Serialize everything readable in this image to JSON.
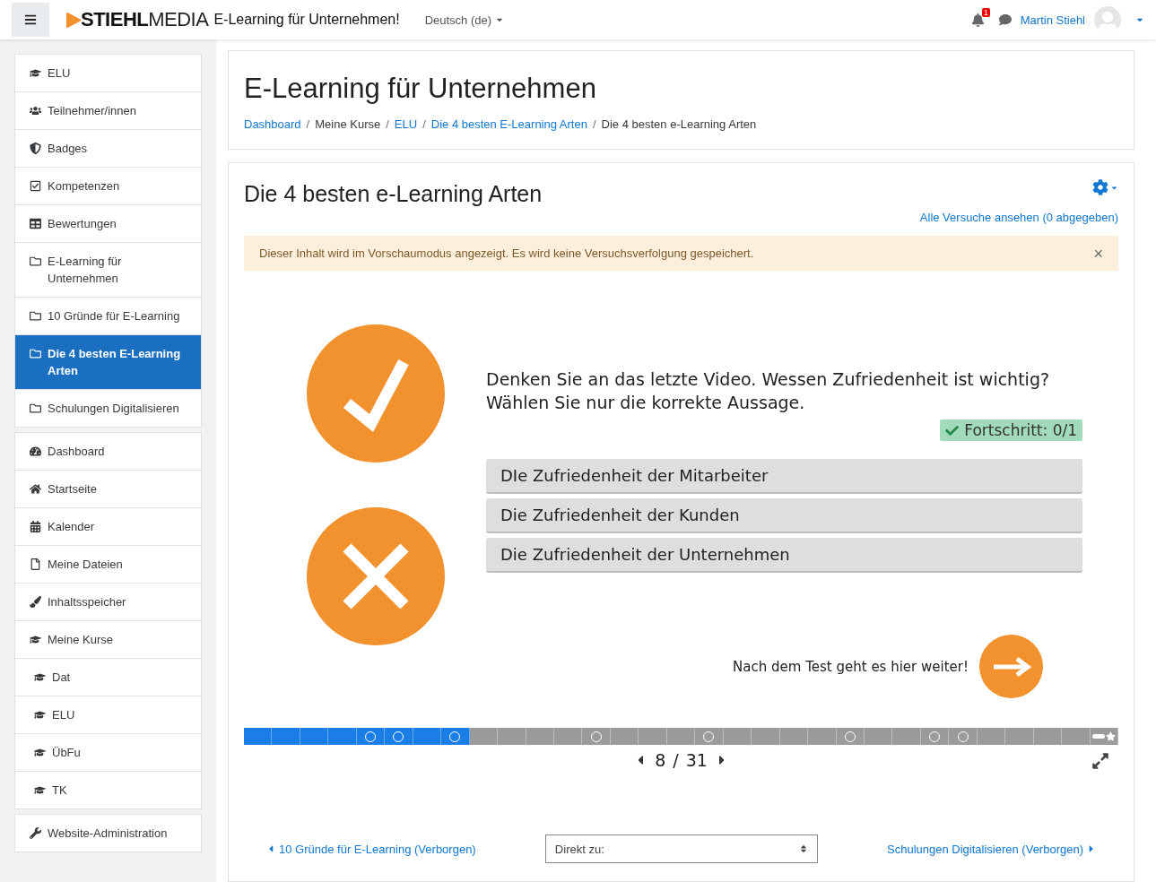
{
  "navbar": {
    "logo_bold": "STIEHL",
    "logo_light": "MEDIA",
    "site_name": "E-Learning für Unternehmen!",
    "language": "Deutsch (de)",
    "notification_count": "1",
    "user_name": "Martin Stiehl"
  },
  "sidebar": {
    "groups": [
      {
        "items": [
          {
            "kind": "course",
            "label": "ELU",
            "selected": false
          },
          {
            "kind": "users",
            "label": "Teilnehmer/innen",
            "selected": false
          },
          {
            "kind": "shield",
            "label": "Badges",
            "selected": false
          },
          {
            "kind": "checkbox",
            "label": "Kompetenzen",
            "selected": false
          },
          {
            "kind": "table",
            "label": "Bewertungen",
            "selected": false
          },
          {
            "kind": "folder",
            "label": "E-Learning für Unternehmen",
            "selected": false
          },
          {
            "kind": "folder",
            "label": "10 Gründe für E-Learning",
            "selected": false
          },
          {
            "kind": "folder",
            "label": "Die 4 besten E-Learning Arten",
            "selected": true
          },
          {
            "kind": "folder",
            "label": "Schulungen Digitalisieren",
            "selected": false
          }
        ]
      },
      {
        "items": [
          {
            "kind": "dashboard",
            "label": "Dashboard",
            "selected": false
          },
          {
            "kind": "home",
            "label": "Startseite",
            "selected": false
          },
          {
            "kind": "calendar",
            "label": "Kalender",
            "selected": false
          },
          {
            "kind": "file",
            "label": "Meine Dateien",
            "selected": false
          },
          {
            "kind": "brush",
            "label": "Inhaltsspeicher",
            "selected": false
          },
          {
            "kind": "course",
            "label": "Meine Kurse",
            "selected": false,
            "children": [
              {
                "kind": "course",
                "label": "Dat",
                "selected": false
              },
              {
                "kind": "course",
                "label": "ELU",
                "selected": false
              },
              {
                "kind": "course",
                "label": "ÜbFu",
                "selected": false
              },
              {
                "kind": "course",
                "label": "TK",
                "selected": false
              }
            ]
          }
        ]
      },
      {
        "items": [
          {
            "kind": "wrench",
            "label": "Website-Administration",
            "selected": false
          }
        ]
      }
    ]
  },
  "header": {
    "title": "E-Learning für Unternehmen",
    "breadcrumb": [
      {
        "kind": "link",
        "label": "Dashboard"
      },
      {
        "kind": "text",
        "separator": "/",
        "label": "Meine Kurse"
      },
      {
        "kind": "link",
        "separator": "/",
        "label": "ELU"
      },
      {
        "kind": "link",
        "separator": "/",
        "label": "Die 4 besten E-Learning Arten"
      },
      {
        "kind": "text",
        "separator": "/",
        "label": "Die 4 besten e-Learning Arten"
      }
    ]
  },
  "activity": {
    "title": "Die 4 besten e-Learning Arten",
    "attempts_link": "Alle Versuche ansehen (0 abgegeben)",
    "notice": "Dieser Inhalt wird im Vorschaumodus angezeigt. Es wird keine Versuchsverfolgung gespeichert.",
    "notice_close": "×",
    "question": "Denken Sie an das letzte Video. Wessen Zufriedenheit ist wichtig? Wählen Sie nur die korrekte Aussage.",
    "progress": "Fortschritt: 0/1",
    "answers": [
      "DIe Zufriedenheit der Mitarbeiter",
      "Die Zufriedenheit der Kunden",
      "Die Zufriedenheit der Unternehmen"
    ],
    "continue_text": "Nach dem Test geht es hier weiter!",
    "timeline": {
      "level": 0.258,
      "segments": [
        {
          "kind": "plain"
        },
        {
          "kind": "plain"
        },
        {
          "kind": "plain"
        },
        {
          "kind": "plain"
        },
        {
          "kind": "circle"
        },
        {
          "kind": "circle"
        },
        {
          "kind": "plain"
        },
        {
          "kind": "circle"
        },
        {
          "kind": "plain"
        },
        {
          "kind": "plain"
        },
        {
          "kind": "plain"
        },
        {
          "kind": "plain"
        },
        {
          "kind": "circle"
        },
        {
          "kind": "plain"
        },
        {
          "kind": "plain"
        },
        {
          "kind": "plain"
        },
        {
          "kind": "circle"
        },
        {
          "kind": "plain"
        },
        {
          "kind": "plain"
        },
        {
          "kind": "plain"
        },
        {
          "kind": "plain"
        },
        {
          "kind": "circle"
        },
        {
          "kind": "plain"
        },
        {
          "kind": "plain"
        },
        {
          "kind": "circle"
        },
        {
          "kind": "circle"
        },
        {
          "kind": "plain"
        },
        {
          "kind": "plain"
        },
        {
          "kind": "plain"
        },
        {
          "kind": "plain"
        },
        {
          "kind": "star"
        }
      ]
    },
    "slide_current": "8",
    "slide_separator": "/",
    "slide_total": "31",
    "prev_link": "10 Gründe für E-Learning (Verborgen)",
    "jump_placeholder": "Direkt zu:",
    "next_link": "Schulungen Digitalisieren (Verborgen)"
  }
}
